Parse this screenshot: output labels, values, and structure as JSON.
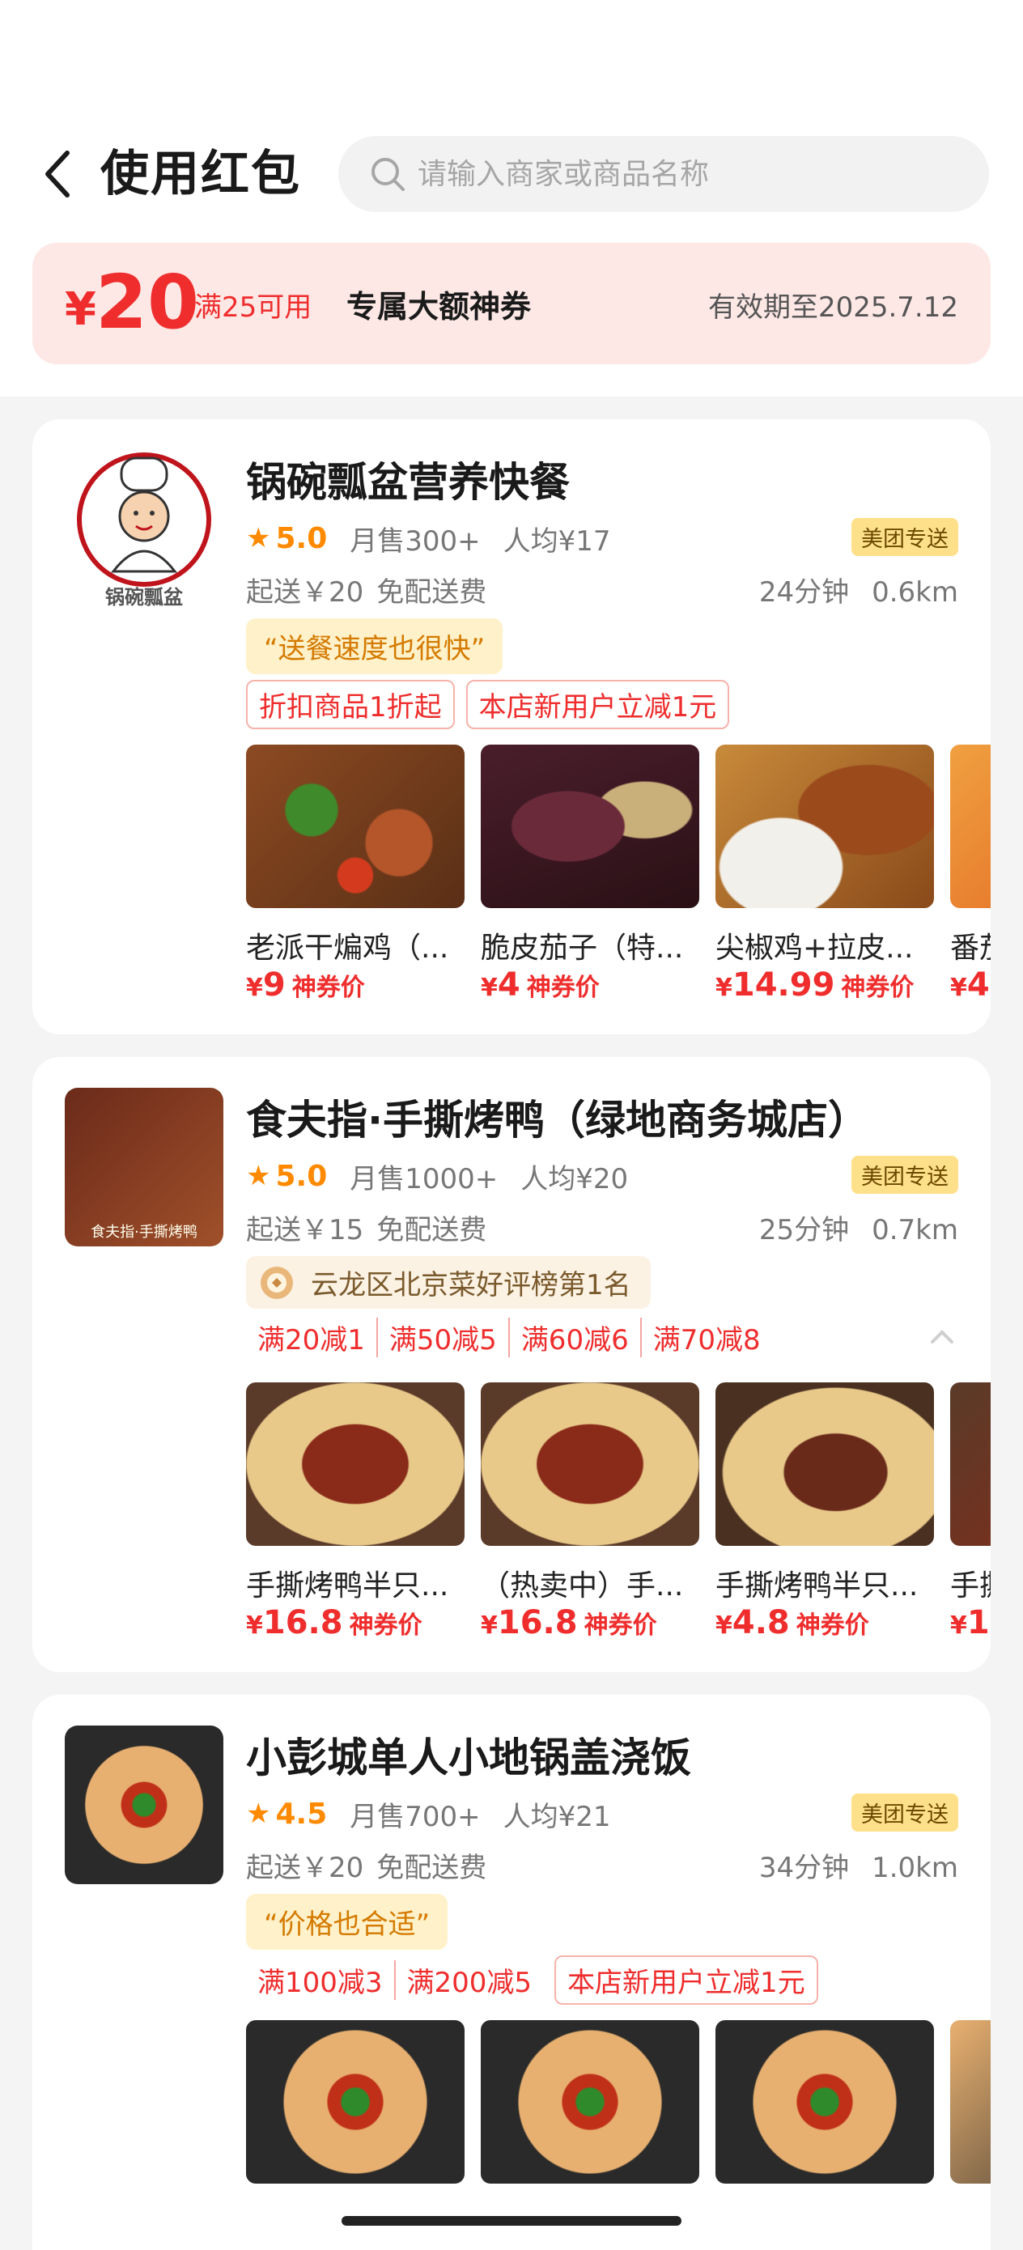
{
  "header": {
    "title": "使用红包",
    "search_placeholder": "请输入商家或商品名称"
  },
  "coupon": {
    "currency": "¥",
    "amount": "20",
    "condition": "满25可用",
    "title": "专属大额神券",
    "validity": "有效期至2025.7.12"
  },
  "shops": [
    {
      "name": "锅碗瓢盆营养快餐",
      "rating": "5.0",
      "sales": "月售300+",
      "avg_price": "人均¥17",
      "badge": "美团专送",
      "min_order": "起送￥20",
      "delivery_fee": "免配送费",
      "time": "24分钟",
      "distance": "0.6km",
      "quote": "“送餐速度也很快”",
      "logo_text": "锅碗瓢盆",
      "promos": [
        "折扣商品1折起",
        "本店新用户立减1元"
      ],
      "products": [
        {
          "name": "老派干煸鸡（...",
          "currency": "¥",
          "price": "9",
          "tag": "神券价"
        },
        {
          "name": "脆皮茄子（特...",
          "currency": "¥",
          "price": "4",
          "tag": "神券价"
        },
        {
          "name": "尖椒鸡+拉皮...",
          "currency": "¥",
          "price": "14.99",
          "tag": "神券价"
        },
        {
          "name": "番茄",
          "currency": "¥",
          "price": "4.",
          "tag": ""
        }
      ]
    },
    {
      "name": "食夫指·手撕烤鸭（绿地商务城店）",
      "rating": "5.0",
      "sales": "月售1000+",
      "avg_price": "人均¥20",
      "badge": "美团专送",
      "min_order": "起送￥15",
      "delivery_fee": "免配送费",
      "time": "25分钟",
      "distance": "0.7km",
      "rank": "云龙区北京菜好评榜第1名",
      "logo_text": "食夫指·手撕烤鸭",
      "promos": [
        "满20减1",
        "满50减5",
        "满60减6",
        "满70减8"
      ],
      "products": [
        {
          "name": "手撕烤鸭半只...",
          "currency": "¥",
          "price": "16.8",
          "tag": "神券价"
        },
        {
          "name": "（热卖中）手...",
          "currency": "¥",
          "price": "16.8",
          "tag": "神券价"
        },
        {
          "name": "手撕烤鸭半只...",
          "currency": "¥",
          "price": "4.8",
          "tag": "神券价"
        },
        {
          "name": "手撕",
          "currency": "¥",
          "price": "1",
          "tag": ""
        }
      ]
    },
    {
      "name": "小彭城单人小地锅盖浇饭",
      "rating": "4.5",
      "sales": "月售700+",
      "avg_price": "人均¥21",
      "badge": "美团专送",
      "min_order": "起送￥20",
      "delivery_fee": "免配送费",
      "time": "34分钟",
      "distance": "1.0km",
      "quote": "“价格也合适”",
      "promos": [
        "满100减3",
        "满200减5",
        "本店新用户立减1元"
      ]
    }
  ],
  "colors": {
    "accent_red": "#ef2d2d",
    "rating_orange": "#ff8a00",
    "badge_yellow": "#ffe08a",
    "coupon_bg": "#fde8e6",
    "list_bg": "#f4f4f4"
  }
}
